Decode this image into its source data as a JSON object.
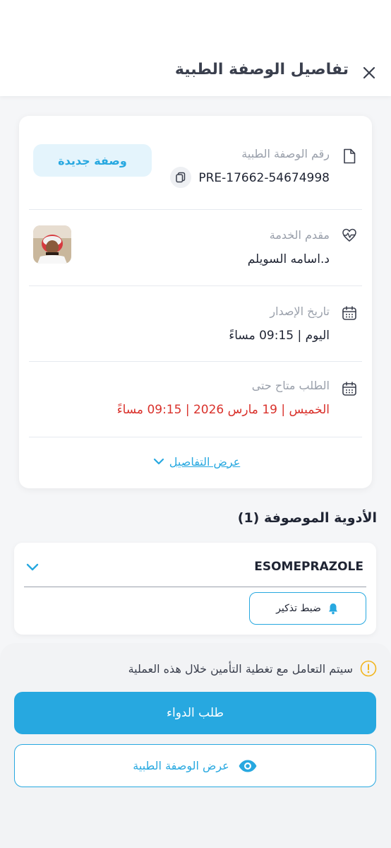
{
  "header": {
    "title": "تفاصيل الوصفة الطبية"
  },
  "prescription": {
    "number_label": "رقم الوصفة الطبية",
    "number_value": "PRE-17662-54674998",
    "status_badge": "وصفة جديدة",
    "provider_label": "مقدم الخدمة",
    "provider_value": "د.اسامه السويلم",
    "issue_label": "تاريخ الإصدار",
    "issue_value": "اليوم | 09:15 مساءً",
    "available_label": "الطلب متاح حتى",
    "available_value": "الخميس | 19 مارس 2026 | 09:15 مساءً",
    "details_link": "عرض التفاصيل"
  },
  "medications": {
    "title": "الأدوية الموصوفة (1)",
    "items": [
      {
        "name": "ESOMEPRAZOLE",
        "reminder_label": "ضبط تذكير"
      }
    ]
  },
  "footer": {
    "notice": "سيتم التعامل مع تغطية التأمين خلال هذه العملية",
    "order_button": "طلب الدواء",
    "view_button": "عرض الوصفة الطبية"
  },
  "colors": {
    "accent": "#27a8e0",
    "danger": "#d9312b",
    "warning": "#f2b51d"
  }
}
